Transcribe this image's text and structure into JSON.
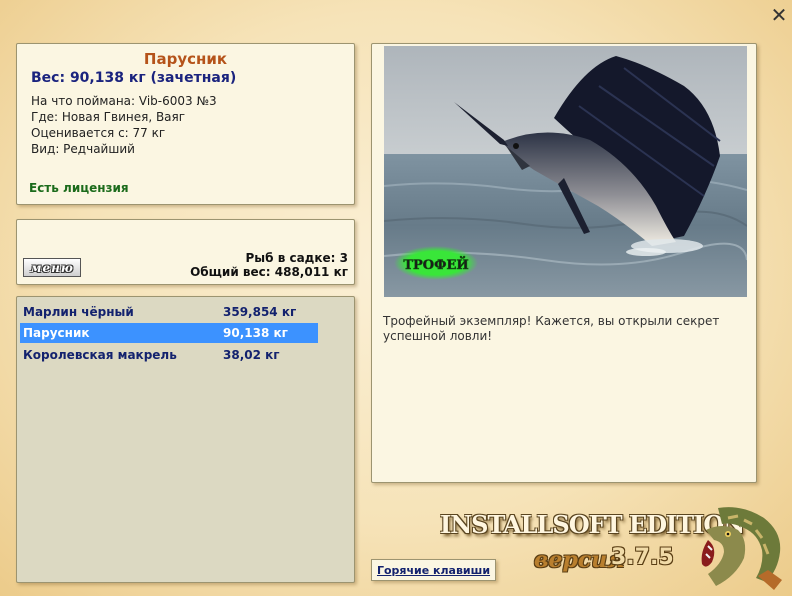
{
  "fish_info": {
    "title": "Парусник",
    "weight": "Вес: 90,138 кг (зачетная)",
    "caught_on": "На что поймана: Vib-6003 №3",
    "where": "Где: Новая Гвинея, Ваяг",
    "valued_from": "Оценивается с: 77 кг",
    "kind": "Вид: Редчайший",
    "license": "Есть лицензия"
  },
  "cage": {
    "menu_label": "меню",
    "count": "Рыб в садке: 3",
    "total_weight": "Общий вес: 488,011 кг"
  },
  "fish_list": [
    {
      "name": "Марлин чёрный",
      "weight": "359,854 кг",
      "selected": false
    },
    {
      "name": "Парусник",
      "weight": "90,138 кг",
      "selected": true
    },
    {
      "name": "Королевская макрель",
      "weight": "38,02 кг",
      "selected": false
    }
  ],
  "photo": {
    "badge": "ТРОФЕЙ",
    "description": "Трофейный экземпляр! Кажется, вы открыли секрет успешной ловли!"
  },
  "footer": {
    "hotkeys_label": "Горячие клавиши",
    "brand": "INSTALLSOFT EDITION",
    "version_label": "версия",
    "version_number": "3.7.5"
  },
  "icons": {
    "close": "close-icon",
    "logo": "pike-fish-icon"
  },
  "colors": {
    "title": "#b5531a",
    "weight": "#1a237e",
    "license": "#1b6b1b",
    "selection": "#3c92ff",
    "badge_glow": "#39e639"
  }
}
